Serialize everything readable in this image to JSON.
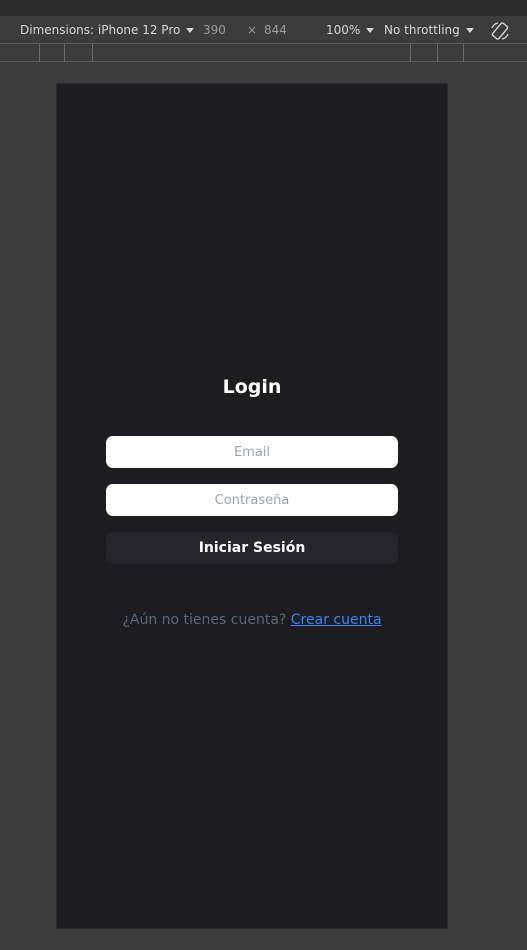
{
  "devtools": {
    "dimensions_label": "Dimensions: iPhone 12 Pro",
    "width_value": "390",
    "times_symbol": "×",
    "height_value": "844",
    "zoom_label": "100%",
    "throttling_label": "No throttling",
    "rotate_icon": "rotate-icon"
  },
  "app": {
    "title": "Login",
    "email_placeholder": "Email",
    "password_placeholder": "Contraseña",
    "submit_label": "Iniciar Sesión",
    "signup_prompt": "¿Aún no tienes cuenta? ",
    "signup_link": "Crear cuenta"
  },
  "colors": {
    "page_bg": "#1c1c21",
    "button_bg": "#25252b",
    "link": "#3b82f6",
    "muted_text": "#5e6675",
    "devtools_bg": "#3c3c3c"
  }
}
